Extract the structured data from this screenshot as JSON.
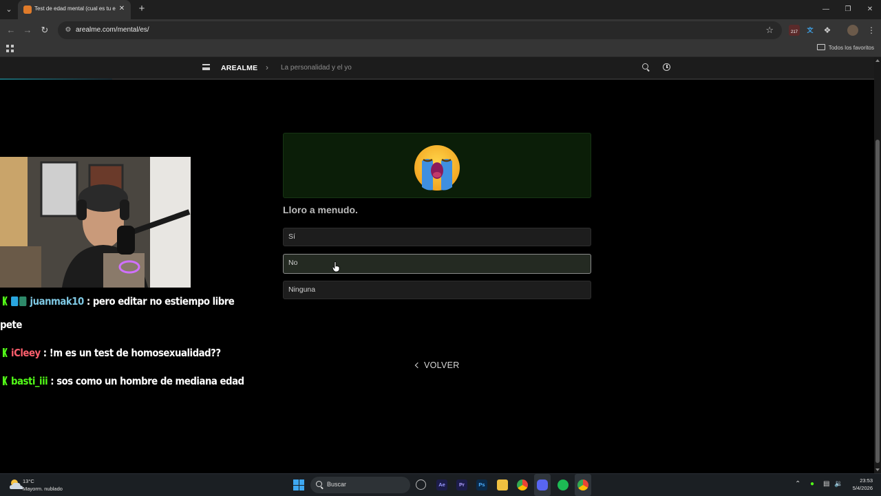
{
  "browser": {
    "tab_title": "Test de edad mental (cual es tu ed",
    "url": "arealme.com/mental/es/",
    "favorites_label": "Todos los favoritos",
    "extension_badge": "217"
  },
  "site": {
    "brand": "AREALME",
    "breadcrumb": "La personalidad y el yo",
    "progress_fraction": 0.128
  },
  "quiz": {
    "question": "Lloro a menudo.",
    "options": [
      "Sí",
      "No",
      "Ninguna"
    ],
    "hovered_option_index": 1,
    "back_label": "VOLVER"
  },
  "chat": {
    "messages": [
      {
        "user": "juanmak10",
        "user_color": "#7ec8e3",
        "text": ": pero editar no estiempo libre",
        "continuation": "pete"
      },
      {
        "user": "iCleey",
        "user_color": "#ff5f6d",
        "text": ": !m es un test de homosexualidad??"
      },
      {
        "user": "basti_iii",
        "user_color": "#53fc18",
        "text": ": sos como un hombre de mediana edad"
      }
    ]
  },
  "taskbar": {
    "weather_temp": "13°C",
    "weather_desc": "Mayorm. nublado",
    "search_label": "Buscar",
    "time": "23:53",
    "date": "5/4/2026"
  },
  "colors": {
    "accent_green": "#53fc18",
    "card_bg": "#0b1e08",
    "page_bg": "#000000"
  }
}
